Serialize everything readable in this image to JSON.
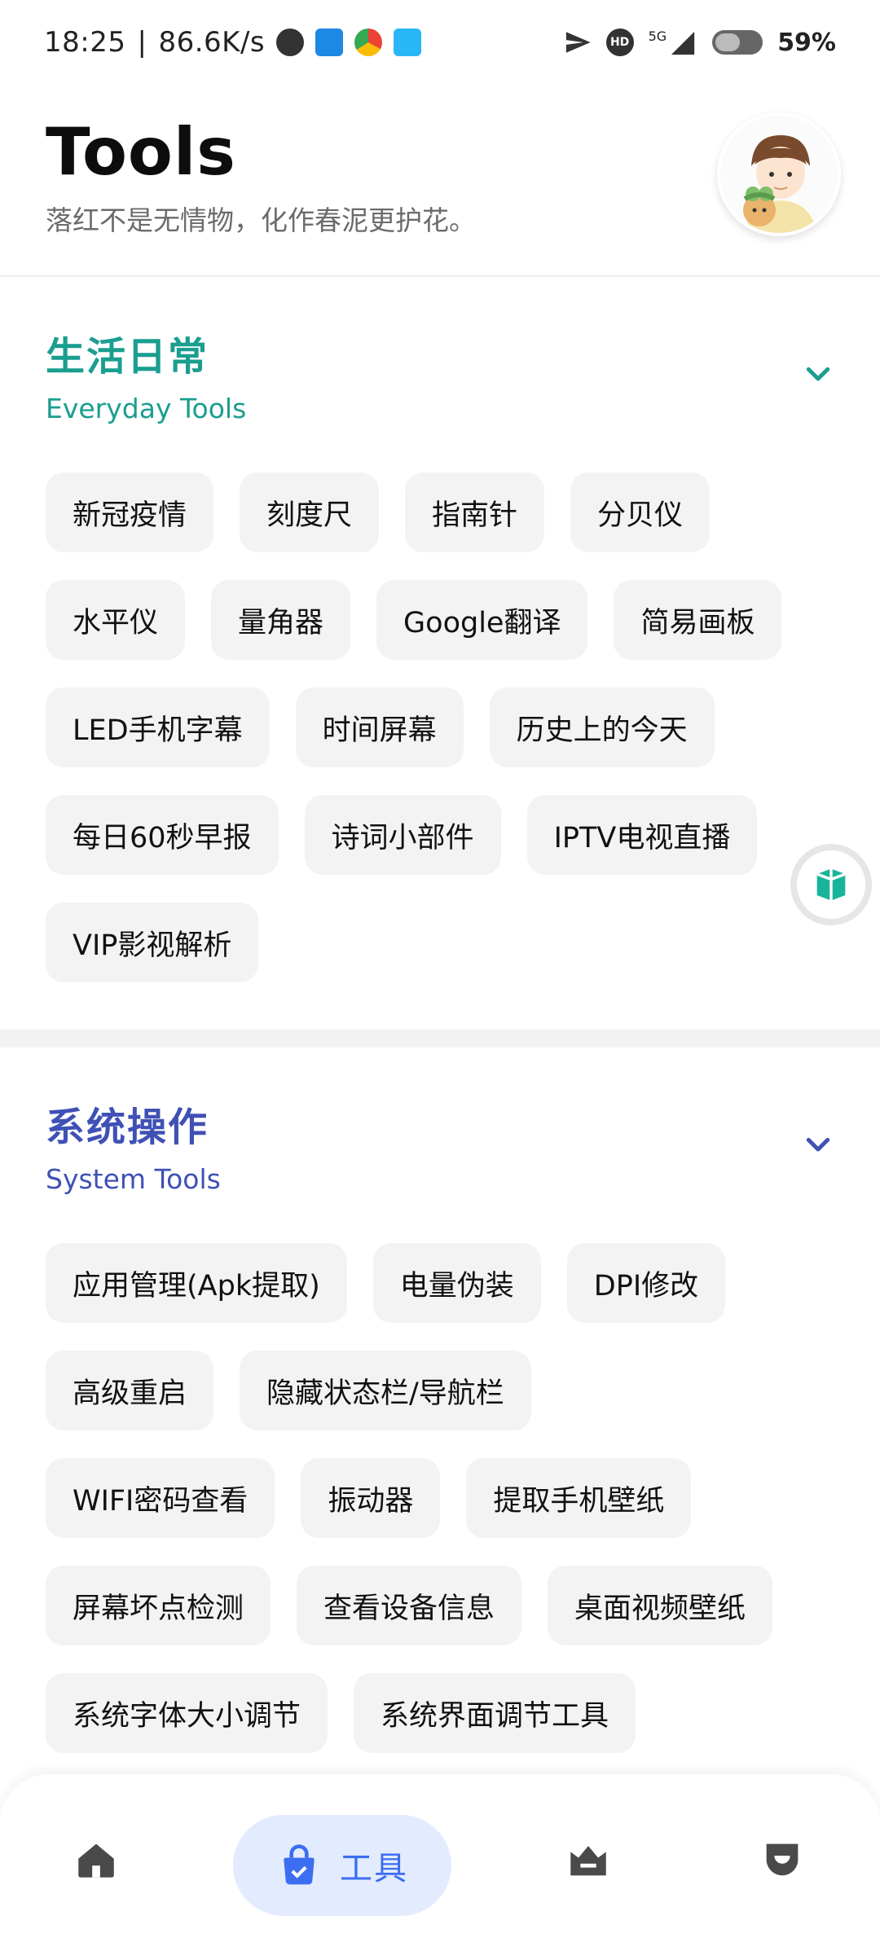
{
  "status": {
    "time": "18:25",
    "net_speed": "86.6K/s",
    "signal": "5G",
    "hd": "HD",
    "battery": "59%"
  },
  "header": {
    "title": "Tools",
    "subtitle": "落红不是无情物，化作春泥更护花。"
  },
  "sections": [
    {
      "title": "生活日常",
      "subtitle": "Everyday Tools",
      "color": "#1a9e8f",
      "rows": [
        [
          "新冠疫情",
          "刻度尺",
          "指南针",
          "分贝仪"
        ],
        [
          "水平仪",
          "量角器",
          "Google翻译",
          "简易画板"
        ],
        [
          "LED手机字幕",
          "时间屏幕",
          "历史上的今天"
        ],
        [
          "每日60秒早报",
          "诗词小部件",
          "IPTV电视直播"
        ],
        [
          "VIP影视解析"
        ]
      ]
    },
    {
      "title": "系统操作",
      "subtitle": "System Tools",
      "color": "#3f51b5",
      "rows": [
        [
          "应用管理(Apk提取)",
          "电量伪装",
          "DPI修改"
        ],
        [
          "高级重启",
          "隐藏状态栏/导航栏"
        ],
        [
          "WIFI密码查看",
          "振动器",
          "提取手机壁纸"
        ],
        [
          "屏幕坏点检测",
          "查看设备信息",
          "桌面视频壁纸"
        ],
        [
          "系统字体大小调节",
          "系统界面调节工具"
        ]
      ]
    }
  ],
  "nav": {
    "active_label": "工具",
    "accent": "#3b6ef0",
    "icons": [
      "home-icon",
      "toolbox-icon",
      "crown-icon",
      "shield-icon"
    ]
  }
}
